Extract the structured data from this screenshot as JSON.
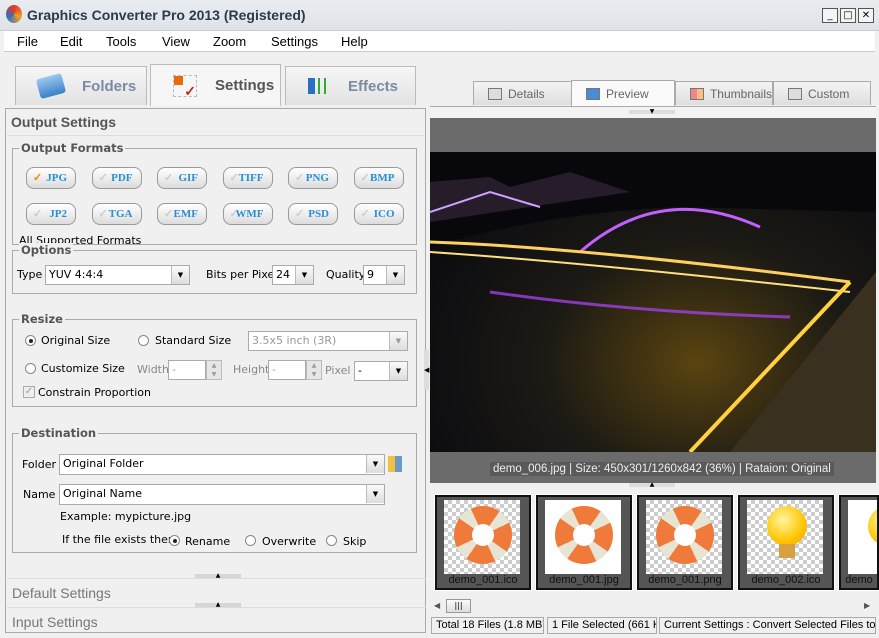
{
  "window": {
    "title": "Graphics Converter Pro 2013  (Registered)"
  },
  "menu": [
    "File",
    "Edit",
    "Tools",
    "View",
    "Zoom",
    "Settings",
    "Help"
  ],
  "main_tabs": [
    {
      "label": "Folders",
      "icon": "folder-icon"
    },
    {
      "label": "Settings",
      "icon": "settings-checklist-icon",
      "active": true
    },
    {
      "label": "Effects",
      "icon": "effects-sliders-icon"
    }
  ],
  "view_tabs": [
    {
      "label": "Details"
    },
    {
      "label": "Preview",
      "active": true
    },
    {
      "label": "Thumbnails"
    },
    {
      "label": "Custom"
    }
  ],
  "output_settings": {
    "title": "Output Settings",
    "formats_label": "Output Formats",
    "formats": [
      "JPG",
      "PDF",
      "GIF",
      "TIFF",
      "PNG",
      "BMP",
      "JP2",
      "TGA",
      "EMF",
      "WMF",
      "PSD",
      "ICO"
    ],
    "selected_format": "JPG",
    "all_supported": "All Supported Formats",
    "options": {
      "label": "Options",
      "type_label": "Type",
      "type_value": "YUV 4:4:4",
      "bpp_label": "Bits per Pixel",
      "bpp_value": "24",
      "quality_label": "Quality",
      "quality_value": "9"
    },
    "resize": {
      "label": "Resize",
      "original": "Original Size",
      "standard": "Standard Size",
      "standard_value": "3.5x5 inch (3R)",
      "customize": "Customize Size",
      "width_label": "Width",
      "width_value": "-",
      "height_label": "Height",
      "height_value": "-",
      "unit_label": "Pixel",
      "unit_value": "-",
      "constrain": "Constrain Proportion",
      "selected": "Original Size",
      "constrain_checked": true
    },
    "destination": {
      "label": "Destination",
      "folder_label": "Folder",
      "folder_value": "Original Folder",
      "name_label": "Name",
      "name_value": "Original Name",
      "example": "Example: mypicture.jpg",
      "exists_label": "If the file exists then",
      "exists_options": [
        "Rename",
        "Overwrite",
        "Skip"
      ],
      "exists_selected": "Rename"
    }
  },
  "collapsed": [
    "Default Settings",
    "Input Settings"
  ],
  "preview": {
    "caption": "demo_006.jpg  |  Size: 450x301/1260x842 (36%)  |  Rataion: Original"
  },
  "thumbnails": [
    {
      "name": "demo_001.ico",
      "kind": "buoy"
    },
    {
      "name": "demo_001.jpg",
      "kind": "buoy"
    },
    {
      "name": "demo_001.png",
      "kind": "buoy"
    },
    {
      "name": "demo_002.ico",
      "kind": "bulb"
    },
    {
      "name": "demo",
      "kind": "bulb"
    }
  ],
  "status": {
    "total": "Total 18 Files (1.8 MB)",
    "selected": "1 File Selected (661 K",
    "current": "Current Settings : Convert Selected Files to J"
  }
}
